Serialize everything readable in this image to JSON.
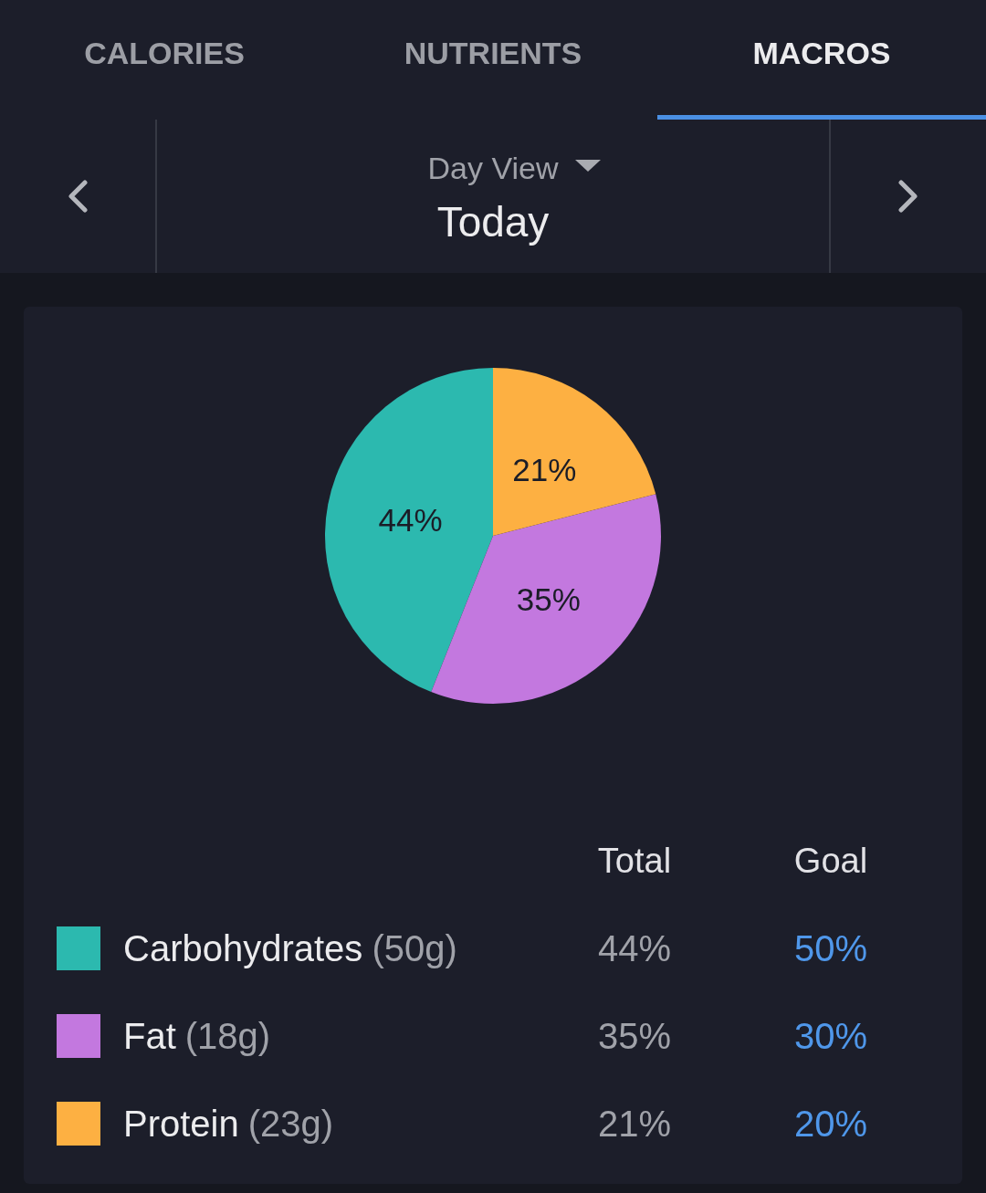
{
  "tabs": [
    {
      "label": "CALORIES",
      "selected": false
    },
    {
      "label": "NUTRIENTS",
      "selected": false
    },
    {
      "label": "MACROS",
      "selected": true
    }
  ],
  "date_nav": {
    "view": "Day View",
    "date": "Today"
  },
  "macros": {
    "chart_data": {
      "type": "pie",
      "values": [
        44,
        35,
        21
      ],
      "value_labels": [
        "44%",
        "35%",
        "21%"
      ]
    },
    "columns": [
      "Total",
      "Goal"
    ],
    "rows": [
      {
        "name": "Carbohydrates",
        "amount": "(50g)",
        "total": "44%",
        "goal": "50%",
        "color": "#2cb9af"
      },
      {
        "name": "Fat",
        "amount": "(18g)",
        "total": "35%",
        "goal": "30%",
        "color": "#c378df"
      },
      {
        "name": "Protein",
        "amount": "(23g)",
        "total": "21%",
        "goal": "20%",
        "color": "#fdb042"
      }
    ]
  }
}
